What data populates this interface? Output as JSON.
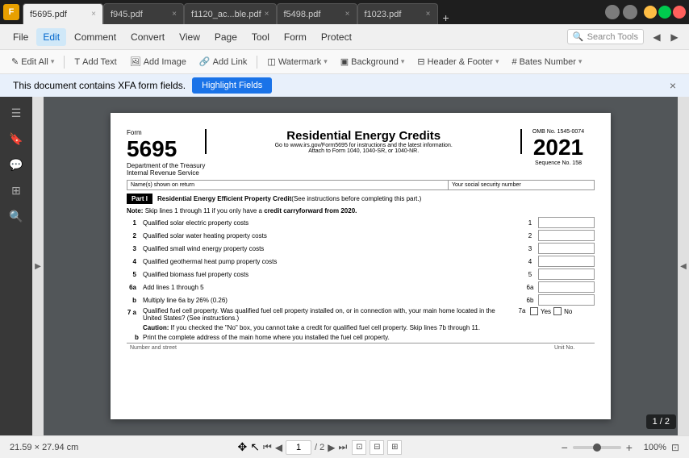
{
  "titlebar": {
    "app_icon_label": "F",
    "tabs": [
      {
        "label": "f5695.pdf",
        "active": true
      },
      {
        "label": "f945.pdf",
        "active": false
      },
      {
        "label": "f1120_ac...ble.pdf",
        "active": false
      },
      {
        "label": "f5498.pdf",
        "active": false
      },
      {
        "label": "f1023.pdf",
        "active": false
      }
    ]
  },
  "menubar": {
    "items": [
      {
        "label": "File"
      },
      {
        "label": "Edit",
        "active": true
      },
      {
        "label": "Comment"
      },
      {
        "label": "Convert"
      },
      {
        "label": "View"
      },
      {
        "label": "Page"
      },
      {
        "label": "Tool"
      },
      {
        "label": "Form"
      },
      {
        "label": "Protect"
      }
    ],
    "search_placeholder": "Search Tools"
  },
  "toolbar": {
    "edit_all": "Edit All",
    "add_text": "Add Text",
    "add_image": "Add Image",
    "add_link": "Add Link",
    "watermark": "Watermark",
    "background": "Background",
    "header_footer": "Header & Footer",
    "bates_number": "Bates Number"
  },
  "xfa_bar": {
    "message": "This document contains XFA form fields.",
    "button_label": "Highlight Fields",
    "close_label": "×"
  },
  "pdf": {
    "form_label": "Form",
    "form_number": "5695",
    "dept_label": "Department of the Treasury",
    "irs_label": "Internal Revenue Service",
    "title": "Residential Energy Credits",
    "subtitle1": "Go to www.irs.gov/Form5695 for instructions and the latest information.",
    "subtitle2": "Attach to Form 1040, 1040-SR, or 1040-NR.",
    "omb_label": "OMB No. 1545-0074",
    "year": "2021",
    "seq_label": "Sequence No. 158",
    "name_label": "Name(s) shown on return",
    "ssn_label": "Your social security number",
    "part1_label": "Part I",
    "part1_title": "Residential Energy Efficient Property Credit",
    "part1_note": "(See instructions before completing this part.)",
    "note_text": "Note:",
    "note_detail": "Skip lines 1 through 11 if you only have a",
    "note_bold": "credit carryforward from 2020.",
    "rows": [
      {
        "num": "1",
        "label": "Qualified solar electric property costs",
        "line": "1"
      },
      {
        "num": "2",
        "label": "Qualified solar water heating property costs",
        "line": "2"
      },
      {
        "num": "3",
        "label": "Qualified small wind energy property costs",
        "line": "3"
      },
      {
        "num": "4",
        "label": "Qualified geothermal heat pump property costs",
        "line": "4"
      },
      {
        "num": "5",
        "label": "Qualified biomass fuel property costs",
        "line": "5"
      },
      {
        "num": "6a",
        "label": "Add lines 1 through 5",
        "line": "6a"
      },
      {
        "num": "b",
        "label": "Multiply line 6a by 26% (0.26)",
        "line": "6b"
      },
      {
        "num": "7a",
        "label": "Qualified fuel cell property. Was qualified fuel cell property installed on, or in connection with, your main home located in the United States? (See instructions.)",
        "line": "7a",
        "has_checkbox": true,
        "yes_label": "Yes",
        "no_label": "No"
      },
      {
        "num": "b",
        "label": "Print the complete address of the main home where you installed the fuel cell property.",
        "line": ""
      },
      {
        "num": "",
        "label": "Number and street",
        "sub": true
      }
    ],
    "caution_label": "Caution:",
    "caution_text": "If you checked the \"No\" box, you cannot take a credit for qualified fuel cell property. Skip lines 7b through 11.",
    "address_label": "Number and street",
    "unit_label": "Unit No."
  },
  "statusbar": {
    "dimensions": "21.59 × 27.94 cm",
    "current_page": "1",
    "total_pages": "2",
    "page_display": "1 / 2",
    "zoom": "100%"
  }
}
